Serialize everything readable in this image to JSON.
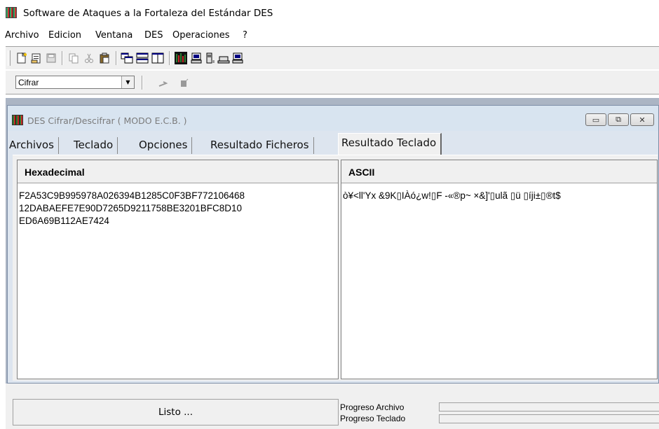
{
  "app": {
    "title": "Software de Ataques a la Fortaleza del Estándar DES"
  },
  "menu": {
    "items": [
      "Archivo",
      "Edicion",
      "Ventana",
      "DES",
      "Operaciones",
      "?"
    ]
  },
  "toolbar": {
    "mode_select_value": "Cifrar"
  },
  "child_window": {
    "caption": "DES Cifrar/Descifrar ( MODO E.C.B. )",
    "minimize_glyph": "▭",
    "restore_glyph": "⧉",
    "close_glyph": "✕"
  },
  "tabs": [
    {
      "label": "Archivos"
    },
    {
      "label": "Teclado"
    },
    {
      "label": "Opciones"
    },
    {
      "label": "Resultado Ficheros"
    },
    {
      "label": "Resultado Teclado",
      "active": true
    }
  ],
  "hex_panel": {
    "header": "Hexadecimal",
    "content": "F2A53C9B995978A026394B1285C0F3BF772106468\n12DABAEFE7E90D7265D9211758BE3201BFC8D10\nED6A69B112AE7424"
  },
  "ascii_panel": {
    "header": "ASCII",
    "content": "ò¥<ll'Yx &9K▯IÀó¿w!▯F -«®p~ ×&]'▯ulã ▯ü ▯íji±▯®t$"
  },
  "status": {
    "main_text": "Listo ...",
    "progress_file_label": "Progreso Archivo",
    "progress_keyboard_label": "Progreso Teclado",
    "progress_file": 0,
    "progress_keyboard": 0
  }
}
